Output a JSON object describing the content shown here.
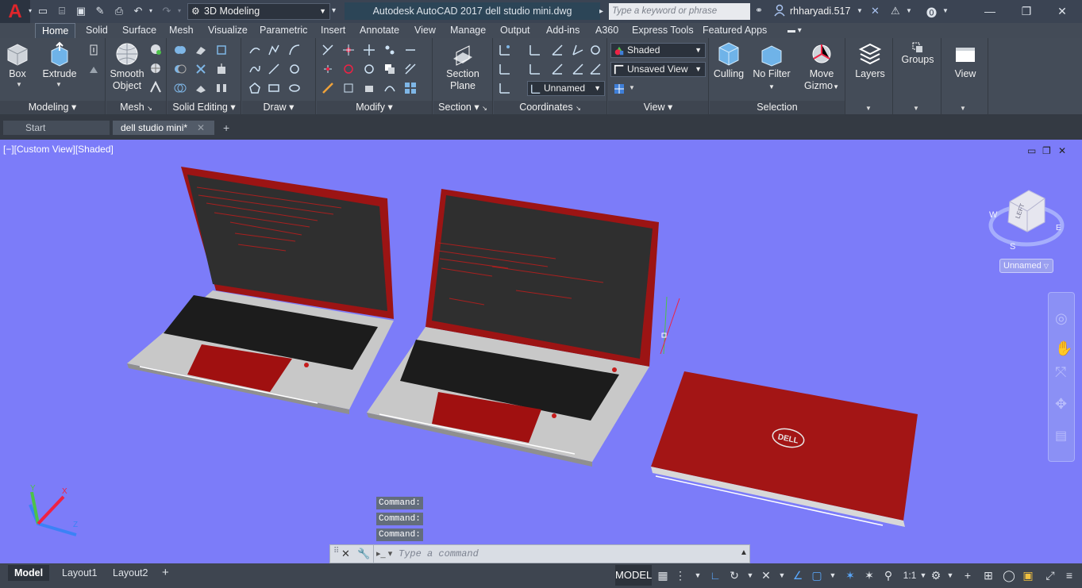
{
  "titlebar": {
    "app_logo": "A",
    "workspace": "3D Modeling",
    "title": "Autodesk AutoCAD 2017    dell studio mini.dwg",
    "search_placeholder": "Type a keyword or phrase",
    "user": "rhharyadi.517"
  },
  "tabs": [
    "Home",
    "Solid",
    "Surface",
    "Mesh",
    "Visualize",
    "Parametric",
    "Insert",
    "Annotate",
    "View",
    "Manage",
    "Output",
    "Add-ins",
    "A360",
    "Express Tools",
    "Featured Apps"
  ],
  "ribbon": {
    "modeling": {
      "title": "Modeling",
      "box": "Box",
      "extrude": "Extrude"
    },
    "mesh": {
      "title": "Mesh",
      "smooth_line1": "Smooth",
      "smooth_line2": "Object"
    },
    "solid_editing": {
      "title": "Solid Editing"
    },
    "draw": {
      "title": "Draw"
    },
    "modify": {
      "title": "Modify"
    },
    "section": {
      "title": "Section",
      "btn_line1": "Section",
      "btn_line2": "Plane"
    },
    "coordinates": {
      "title": "Coordinates",
      "ucs": "Unnamed"
    },
    "view": {
      "title": "View",
      "visual_style": "Shaded",
      "named_view": "Unsaved View"
    },
    "selection": {
      "title": "Selection",
      "culling": "Culling",
      "no_filter": "No Filter",
      "gizmo_line1": "Move",
      "gizmo_line2": "Gizmo"
    },
    "layers": {
      "title": "Layers"
    },
    "groups": {
      "title": "Groups"
    },
    "viewpanel": {
      "title": "View"
    }
  },
  "doctabs": {
    "start": "Start",
    "current": "dell studio mini*"
  },
  "viewport": {
    "label": "[−][Custom View][Shaded]",
    "viewcube_label": "Unnamed",
    "viewcube_face": "LEFT",
    "compass": {
      "w": "W",
      "s": "S",
      "e": "E"
    },
    "logo_text": "DELL",
    "ucs_axes": {
      "x": "X",
      "y": "Y",
      "z": "Z"
    }
  },
  "command": {
    "history": [
      "Command:",
      "Command:",
      "Command:"
    ],
    "placeholder": "Type a command"
  },
  "layout_tabs": [
    "Model",
    "Layout1",
    "Layout2"
  ],
  "status": {
    "model": "MODEL",
    "scale": "1:1"
  },
  "colors": {
    "viewport_bg": "#7c7cf9",
    "laptop_red": "#a81414",
    "accent": "#e0262b"
  }
}
